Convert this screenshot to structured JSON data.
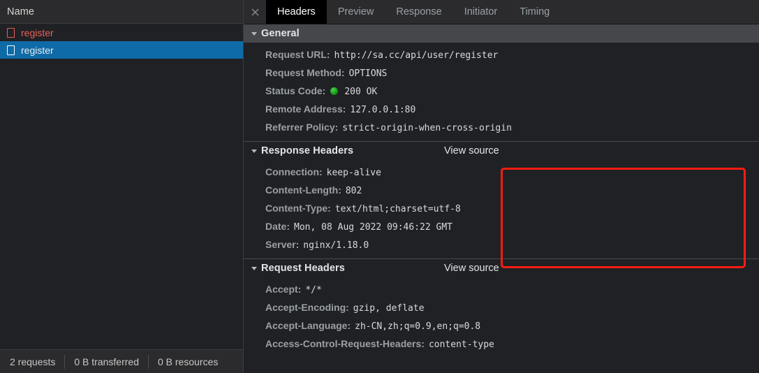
{
  "left_panel": {
    "column_header": "Name",
    "requests": [
      {
        "label": "register",
        "icon": "document-icon",
        "state": "failed"
      },
      {
        "label": "register",
        "icon": "document-icon",
        "state": "selected"
      }
    ],
    "status_bar": {
      "requests": "2 requests",
      "transferred": "0 B transferred",
      "resources": "0 B resources"
    }
  },
  "right_panel": {
    "close_icon": "close-icon",
    "tabs": [
      {
        "label": "Headers",
        "active": true
      },
      {
        "label": "Preview",
        "active": false
      },
      {
        "label": "Response",
        "active": false
      },
      {
        "label": "Initiator",
        "active": false
      },
      {
        "label": "Timing",
        "active": false
      }
    ],
    "sections": [
      {
        "title": "General",
        "view_source": null,
        "shaded": true,
        "rows": [
          {
            "key": "Request URL:",
            "value": "http://sa.cc/api/user/register"
          },
          {
            "key": "Request Method:",
            "value": "OPTIONS"
          },
          {
            "key": "Status Code:",
            "value": "200 OK",
            "dot": "status-ok-dot"
          },
          {
            "key": "Remote Address:",
            "value": "127.0.0.1:80"
          },
          {
            "key": "Referrer Policy:",
            "value": "strict-origin-when-cross-origin"
          }
        ]
      },
      {
        "title": "Response Headers",
        "view_source": "View source",
        "shaded": false,
        "rows": [
          {
            "key": "Connection:",
            "value": "keep-alive"
          },
          {
            "key": "Content-Length:",
            "value": "802"
          },
          {
            "key": "Content-Type:",
            "value": "text/html;charset=utf-8"
          },
          {
            "key": "Date:",
            "value": "Mon, 08 Aug 2022 09:46:22 GMT"
          },
          {
            "key": "Server:",
            "value": "nginx/1.18.0"
          }
        ]
      },
      {
        "title": "Request Headers",
        "view_source": "View source",
        "shaded": false,
        "rows": [
          {
            "key": "Accept:",
            "value": "*/*"
          },
          {
            "key": "Accept-Encoding:",
            "value": "gzip, deflate"
          },
          {
            "key": "Accept-Language:",
            "value": "zh-CN,zh;q=0.9,en;q=0.8"
          },
          {
            "key": "Access-Control-Request-Headers:",
            "value": "content-type"
          }
        ]
      }
    ]
  },
  "annotation": {
    "highlight_color": "#fc1c11",
    "target": "response-headers-rows"
  },
  "colors": {
    "selection_blue": "#0f6ba8",
    "failed_red": "#e8605a",
    "status_green": "#18a018",
    "panel_bg": "#202124",
    "header_bg": "#46474a"
  }
}
